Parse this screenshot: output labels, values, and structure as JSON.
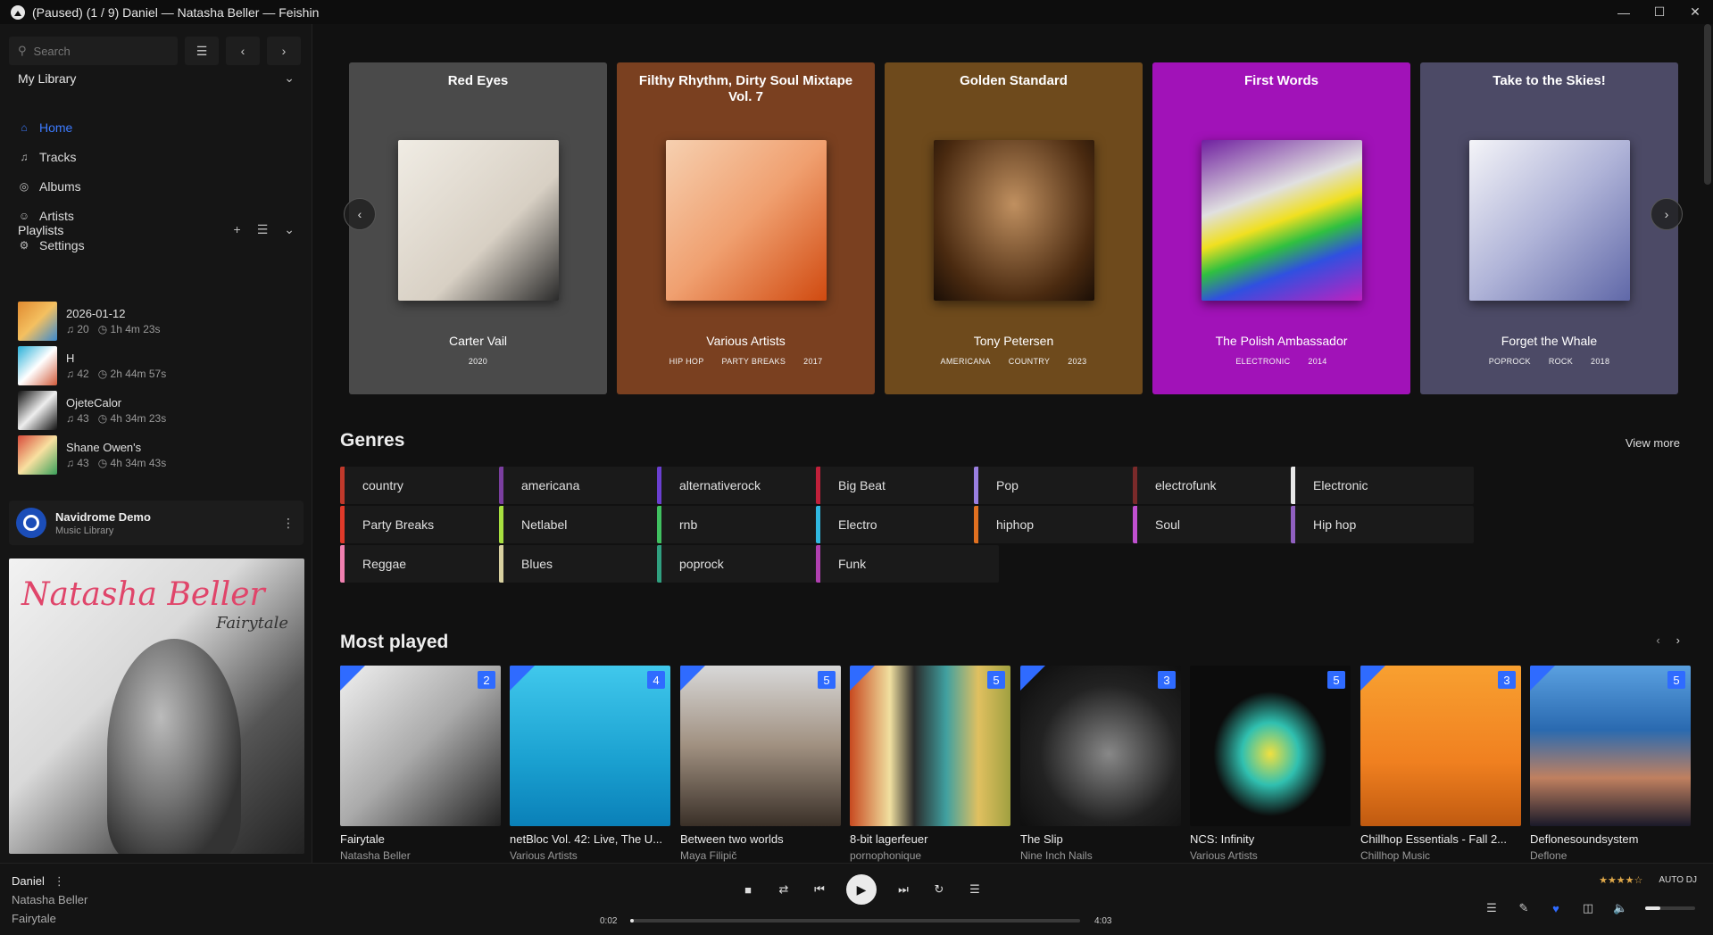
{
  "window": {
    "title": "(Paused) (1 / 9) Daniel — Natasha Beller — Feishin"
  },
  "sidebar": {
    "search_placeholder": "Search",
    "library_title": "My Library",
    "nav": [
      {
        "label": "Home",
        "icon": "home-icon"
      },
      {
        "label": "Tracks",
        "icon": "music-note-icon"
      },
      {
        "label": "Albums",
        "icon": "disc-icon"
      },
      {
        "label": "Artists",
        "icon": "user-icon"
      },
      {
        "label": "Settings",
        "icon": "gear-icon"
      }
    ],
    "playlists_title": "Playlists",
    "playlists": [
      {
        "name": "2026-01-12",
        "tracks": "20",
        "duration": "1h 4m 23s"
      },
      {
        "name": "H",
        "tracks": "42",
        "duration": "2h 44m 57s"
      },
      {
        "name": "OjeteCalor",
        "tracks": "43",
        "duration": "4h 34m 23s"
      },
      {
        "name": "Shane Owen's",
        "tracks": "43",
        "duration": "4h 34m 43s"
      }
    ],
    "server": {
      "name": "Navidrome Demo",
      "subtitle": "Music Library"
    },
    "now_playing_art": {
      "title": "Natasha Beller",
      "subtitle": "Fairytale"
    }
  },
  "carousel": [
    {
      "title": "Red Eyes",
      "artist": "Carter Vail",
      "tags": [
        "2020"
      ],
      "color": "#4a4a4a"
    },
    {
      "title": "Filthy Rhythm, Dirty Soul Mixtape Vol. 7",
      "artist": "Various Artists",
      "tags": [
        "HIP HOP",
        "PARTY BREAKS",
        "2017"
      ],
      "color": "#7a4020"
    },
    {
      "title": "Golden Standard",
      "artist": "Tony Petersen",
      "tags": [
        "AMERICANA",
        "COUNTRY",
        "2023"
      ],
      "color": "#6e4a1c"
    },
    {
      "title": "First Words",
      "artist": "The Polish Ambassador",
      "tags": [
        "ELECTRONIC",
        "2014"
      ],
      "color": "#a112b8"
    },
    {
      "title": "Take to the Skies!",
      "artist": "Forget the Whale",
      "tags": [
        "POPROCK",
        "ROCK",
        "2018"
      ],
      "color": "#4c4a66"
    }
  ],
  "genres_title": "Genres",
  "view_more": "View more",
  "genres": [
    {
      "label": "country",
      "color": "#c0392b"
    },
    {
      "label": "americana",
      "color": "#7b3fa0"
    },
    {
      "label": "alternativerock",
      "color": "#6a3fd0"
    },
    {
      "label": "Big Beat",
      "color": "#c0203a"
    },
    {
      "label": "Pop",
      "color": "#9a7fe0"
    },
    {
      "label": "electrofunk",
      "color": "#7a2a2a"
    },
    {
      "label": "Electronic",
      "color": "#e8e8e8"
    },
    {
      "label": "Party Breaks",
      "color": "#e03a2a"
    },
    {
      "label": "Netlabel",
      "color": "#a8e040"
    },
    {
      "label": "rnb",
      "color": "#40c060"
    },
    {
      "label": "Electro",
      "color": "#30b8e0"
    },
    {
      "label": "hiphop",
      "color": "#e07020"
    },
    {
      "label": "Soul",
      "color": "#c050d0"
    },
    {
      "label": "Hip hop",
      "color": "#9060c0"
    },
    {
      "label": "Reggae",
      "color": "#f080b0"
    },
    {
      "label": "Blues",
      "color": "#d8d0a0"
    },
    {
      "label": "poprock",
      "color": "#30a080"
    },
    {
      "label": "Funk",
      "color": "#b040b0"
    }
  ],
  "most_played_title": "Most played",
  "most_played": [
    {
      "name": "Fairytale",
      "artist": "Natasha Beller",
      "count": "2",
      "color": "#bdbdbd"
    },
    {
      "name": "netBloc Vol. 42: Live, The U...",
      "artist": "Various Artists",
      "count": "4",
      "color": "#22b4dc"
    },
    {
      "name": "Between two worlds",
      "artist": "Maya Filipič",
      "count": "5",
      "color": "#8a7a6a"
    },
    {
      "name": "8-bit lagerfeuer",
      "artist": "pornophonique",
      "count": "5",
      "color": "#c8a050"
    },
    {
      "name": "The Slip",
      "artist": "Nine Inch Nails",
      "count": "3",
      "color": "#1a1a1a"
    },
    {
      "name": "NCS: Infinity",
      "artist": "Various Artists",
      "count": "5",
      "color": "#0c0c0c"
    },
    {
      "name": "Chillhop Essentials - Fall 2...",
      "artist": "Chillhop Music",
      "count": "3",
      "color": "#f08a20"
    },
    {
      "name": "Deflonesoundsystem",
      "artist": "Deflone",
      "count": "5",
      "color": "#2a6ab0"
    }
  ],
  "player": {
    "title": "Daniel",
    "artist": "Natasha Beller",
    "album": "Fairytale",
    "elapsed": "0:02",
    "duration": "4:03",
    "progress_fraction": 0.008,
    "rating_stars": "★★★★☆",
    "auto_dj": "AUTO DJ",
    "volume_fraction": 0.3
  },
  "colors": {
    "accent": "#2f6bff",
    "background": "#111111"
  }
}
